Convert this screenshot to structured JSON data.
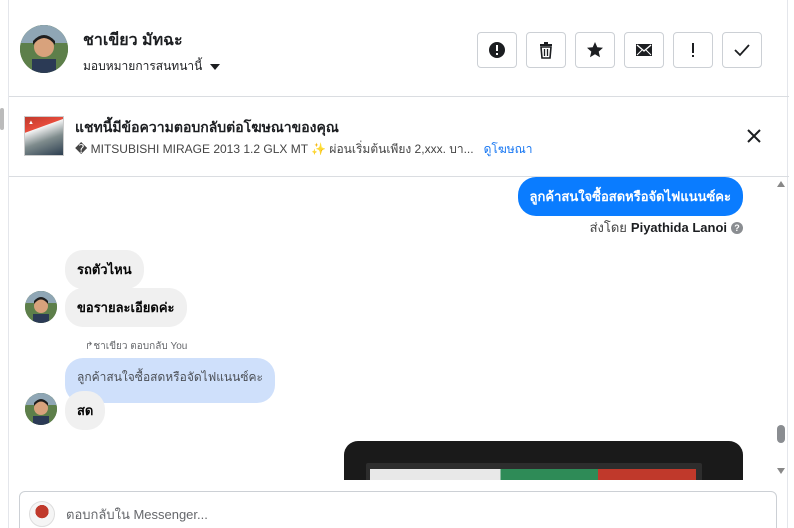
{
  "header": {
    "contact_name": "ชาเขียว มัทฉะ",
    "assign_label": "มอบหมายการสนทนานี้",
    "toolbar": [
      {
        "name": "report-button",
        "icon": "alert-circle-icon"
      },
      {
        "name": "delete-button",
        "icon": "trash-icon"
      },
      {
        "name": "star-button",
        "icon": "star-icon"
      },
      {
        "name": "mark-unread-button",
        "icon": "envelope-icon"
      },
      {
        "name": "follow-up-button",
        "icon": "exclamation-icon"
      },
      {
        "name": "mark-done-button",
        "icon": "check-icon"
      }
    ]
  },
  "ad_context": {
    "title": "แชทนี้มีข้อความตอบกลับต่อโฆษณาของคุณ",
    "subtitle": "� MITSUBISHI MIRAGE 2013 1.2 GLX MT ✨ ผ่อนเริ่มต้นเพียง 2,xxx. บา...",
    "link": "ดูโฆษณา"
  },
  "messages": {
    "outgoing_1": "ลูกค้าสนใจซื้อสดหรือจัดไฟแนนซ์คะ",
    "sent_by_prefix": "ส่งโดย",
    "sent_by_name": "Piyathida Lanoi",
    "incoming_1": "รถตัวไหน",
    "incoming_2": "ขอรายละเอียดค่ะ",
    "reply_note": "ชาเขียว ตอบกลับ You",
    "quoted": "ลูกค้าสนใจซื้อสดหรือจัดไฟแนนซ์คะ",
    "incoming_3": "สด"
  },
  "composer": {
    "placeholder": "ตอบกลับใน Messenger..."
  },
  "colors": {
    "outgoing_bubble": "#0a7cff",
    "incoming_bubble": "#f0f0f0",
    "quoted_bubble": "#cfe0fb",
    "link": "#1877f2"
  }
}
